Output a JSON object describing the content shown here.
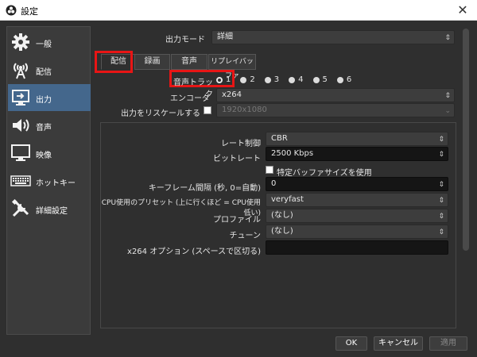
{
  "window": {
    "title": "設定",
    "close_glyph": "✕"
  },
  "sidebar": {
    "items": [
      {
        "label": "一般",
        "icon": "gear-icon"
      },
      {
        "label": "配信",
        "icon": "broadcast-antenna-icon"
      },
      {
        "label": "出力",
        "icon": "output-monitor-icon",
        "active": true
      },
      {
        "label": "音声",
        "icon": "speaker-icon"
      },
      {
        "label": "映像",
        "icon": "monitor-icon"
      },
      {
        "label": "ホットキー",
        "icon": "keyboard-icon"
      },
      {
        "label": "詳細設定",
        "icon": "tools-icon"
      }
    ]
  },
  "output": {
    "mode_label": "出力モード",
    "mode_value": "詳細",
    "tabs": [
      "配信",
      "録画",
      "音声",
      "リプレイバッファ"
    ],
    "active_tab": "配信",
    "audio_track_label": "音声トラック",
    "audio_tracks": [
      "1",
      "2",
      "3",
      "4",
      "5",
      "6"
    ],
    "selected_track": "1",
    "encoder_label": "エンコーダ",
    "encoder_value": "x264",
    "rescale_label": "出力をリスケールする",
    "rescale_value": "1920x1080",
    "rate_control_label": "レート制御",
    "rate_control_value": "CBR",
    "bitrate_label": "ビットレート",
    "bitrate_value": "2500 Kbps",
    "custom_buffer_label": "特定バッファサイズを使用",
    "keyframe_label": "キーフレーム間隔 (秒, 0=自動)",
    "keyframe_value": "0",
    "preset_label": "CPU使用のプリセット (上に行くほど = CPU使用低い)",
    "preset_value": "veryfast",
    "profile_label": "プロファイル",
    "profile_value": "(なし)",
    "tune_label": "チューン",
    "tune_value": "(なし)",
    "x264opts_label": "x264 オプション (スペースで区切る)",
    "x264opts_value": ""
  },
  "buttons": {
    "ok": "OK",
    "cancel": "キャンセル",
    "apply": "適用"
  },
  "colors": {
    "highlight": "#e81515",
    "active_sidebar": "#44678c"
  }
}
